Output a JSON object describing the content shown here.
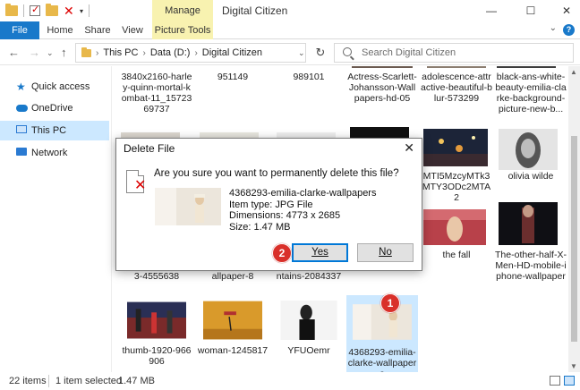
{
  "window": {
    "title": "Digital Citizen",
    "manage_tab": "Manage",
    "minimize": "—",
    "maximize": "☐",
    "close": "✕"
  },
  "ribbon": {
    "tabs": [
      "File",
      "Home",
      "Share",
      "View",
      "Picture Tools"
    ]
  },
  "address": {
    "crumbs": [
      "This PC",
      "Data (D:)",
      "Digital Citizen"
    ],
    "search_placeholder": "Search Digital Citizen"
  },
  "sidebar": {
    "items": [
      {
        "label": "Quick access",
        "icon": "star-icon"
      },
      {
        "label": "OneDrive",
        "icon": "cloud-icon"
      },
      {
        "label": "This PC",
        "icon": "computer-icon",
        "selected": true
      },
      {
        "label": "Network",
        "icon": "network-icon"
      }
    ]
  },
  "files": [
    {
      "caption": "3840x2160-harley-quinn-mortal-kombat-11_1572369737"
    },
    {
      "caption": "951149"
    },
    {
      "caption": "989101"
    },
    {
      "caption": "Actress-Scarlett-Johansson-Wallpapers-hd-05"
    },
    {
      "caption": "adolescence-attractive-beautiful-blur-573299"
    },
    {
      "caption": "black-ans-white-beauty-emilia-clarke-background-picture-new-b..."
    },
    {
      "caption": "MTI5MzcyMTk3MTY3ODc2MTA2"
    },
    {
      "caption": "olivia wilde"
    },
    {
      "caption": "the fall"
    },
    {
      "caption": "The-other-half-X-Men-HD-mobile-iphone-wallpaper"
    },
    {
      "caption": "3-4555638"
    },
    {
      "caption": "allpaper-8"
    },
    {
      "caption": "ntains-2084337"
    },
    {
      "caption": "thumb-1920-966906"
    },
    {
      "caption": "woman-1245817"
    },
    {
      "caption": "YFUOemr"
    },
    {
      "caption": "4368293-emilia-clarke-wallpapers"
    }
  ],
  "status": {
    "items_count": "22 items",
    "selected": "1 item selected",
    "size": "1.47 MB"
  },
  "dialog": {
    "title": "Delete File",
    "question": "Are you sure you want to permanently delete this file?",
    "file_name": "4368293-emilia-clarke-wallpapers",
    "item_type": "Item type: JPG File",
    "dimensions": "Dimensions: 4773 x 2685",
    "size": "Size: 1.47 MB",
    "yes_label": "Yes",
    "no_label": "No"
  },
  "badges": [
    "1",
    "2"
  ],
  "colors": {
    "accent": "#1979ca",
    "manage_tab": "#f8f2b0",
    "selection": "#cce8ff",
    "badge": "#d9302a"
  }
}
